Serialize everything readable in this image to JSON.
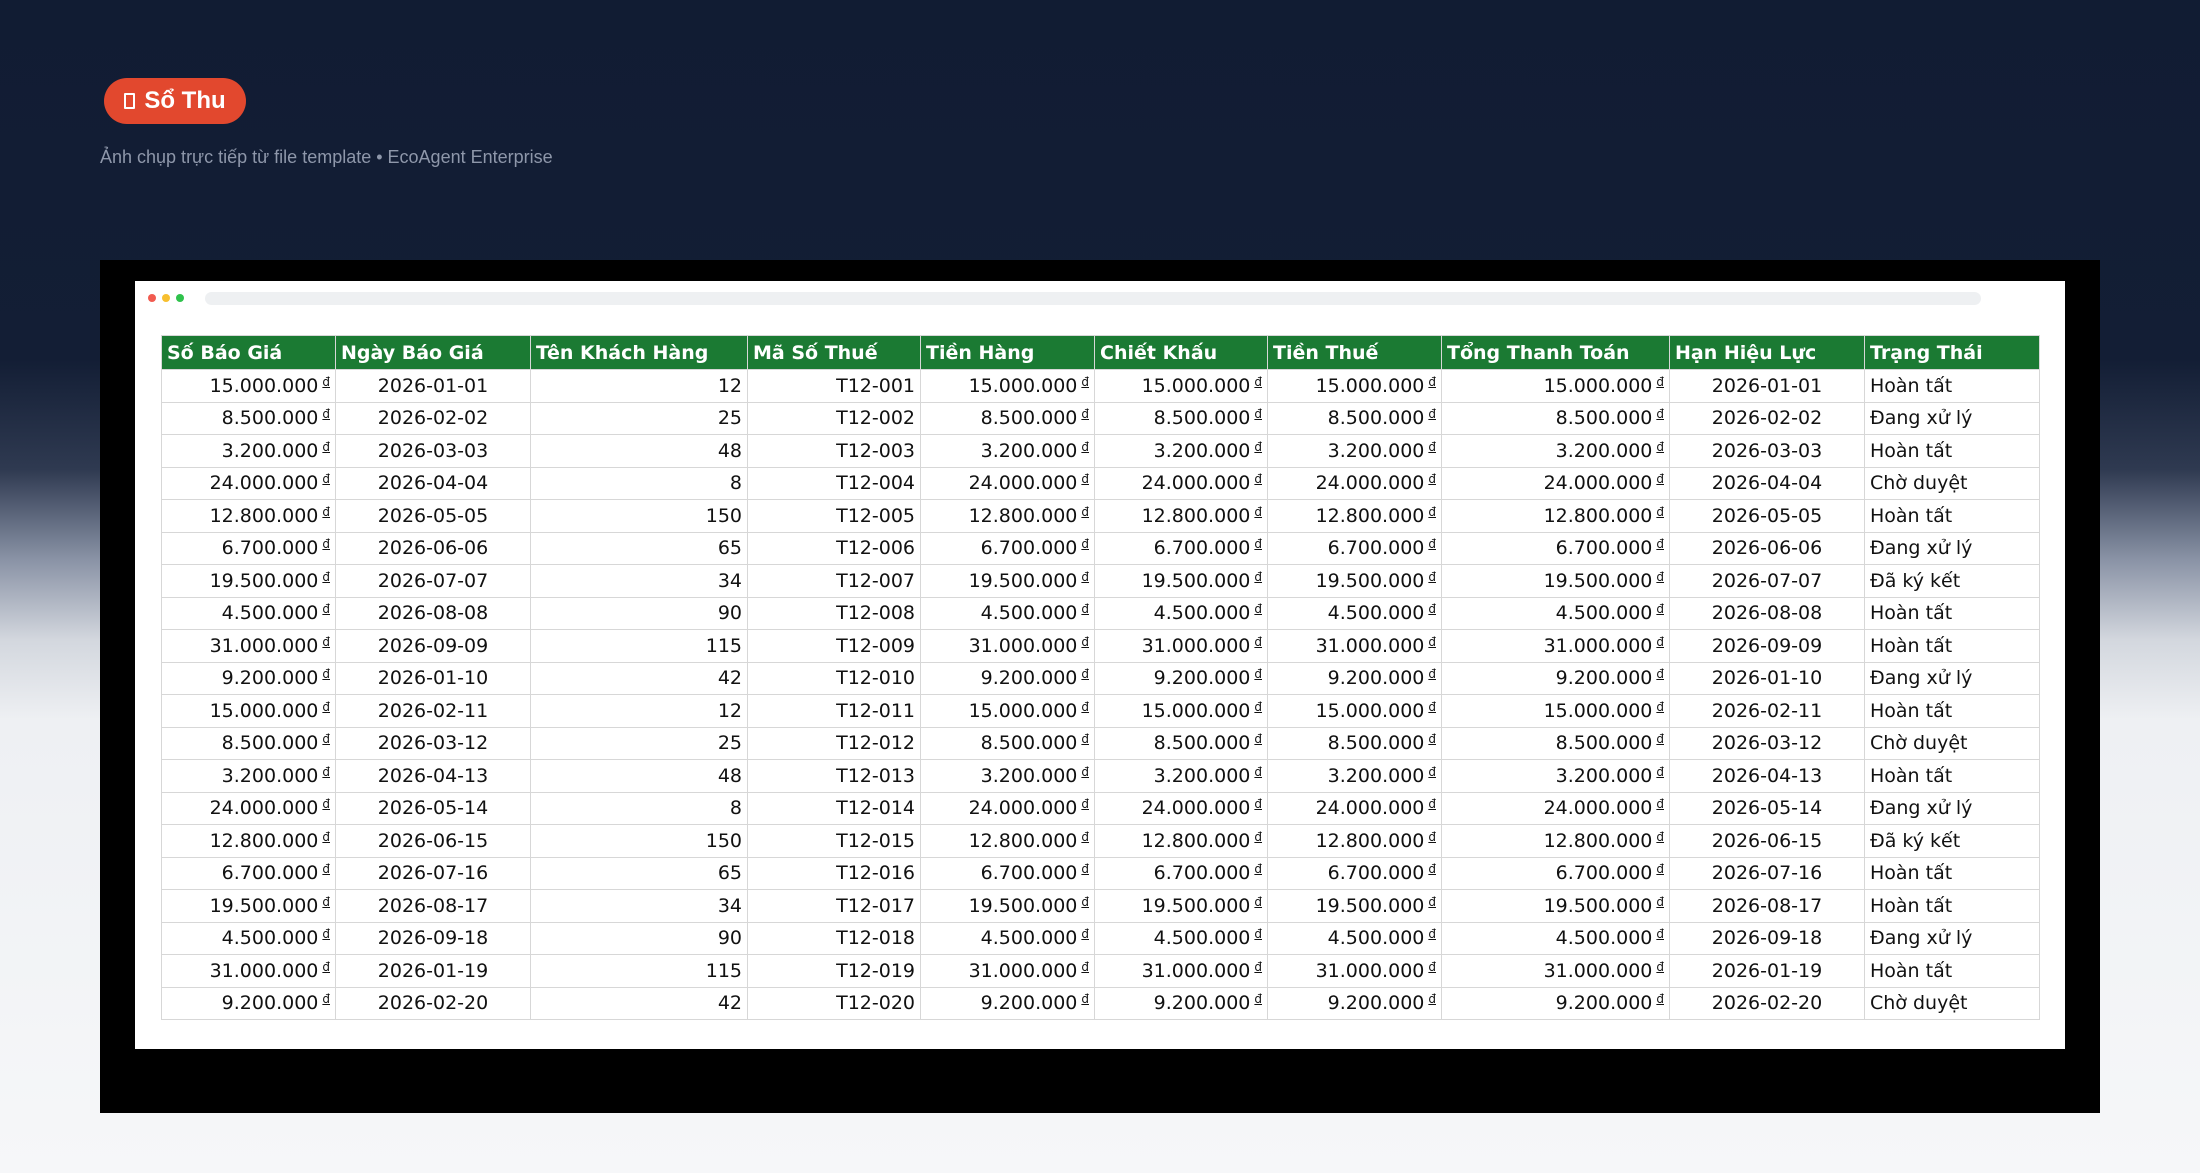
{
  "badge": {
    "label": "Sổ Thu"
  },
  "subtitle": "Ảnh chụp trực tiếp từ file template • EcoAgent Enterprise",
  "sheet": {
    "currency_symbol": "đ",
    "headers": [
      "Số Báo Giá",
      "Ngày Báo Giá",
      "Tên Khách Hàng",
      "Mã Số Thuế",
      "Tiền Hàng",
      "Chiết Khấu",
      "Tiền Thuế",
      "Tổng Thanh Toán",
      "Hạn Hiệu Lực",
      "Trạng Thái"
    ],
    "rows": [
      {
        "amount": "15.000.000",
        "date": "2026-01-01",
        "qty": "12",
        "code": "T12-001",
        "status": "Hoàn tất"
      },
      {
        "amount": "8.500.000",
        "date": "2026-02-02",
        "qty": "25",
        "code": "T12-002",
        "status": "Đang xử lý"
      },
      {
        "amount": "3.200.000",
        "date": "2026-03-03",
        "qty": "48",
        "code": "T12-003",
        "status": "Hoàn tất"
      },
      {
        "amount": "24.000.000",
        "date": "2026-04-04",
        "qty": "8",
        "code": "T12-004",
        "status": "Chờ duyệt"
      },
      {
        "amount": "12.800.000",
        "date": "2026-05-05",
        "qty": "150",
        "code": "T12-005",
        "status": "Hoàn tất"
      },
      {
        "amount": "6.700.000",
        "date": "2026-06-06",
        "qty": "65",
        "code": "T12-006",
        "status": "Đang xử lý"
      },
      {
        "amount": "19.500.000",
        "date": "2026-07-07",
        "qty": "34",
        "code": "T12-007",
        "status": "Đã ký kết"
      },
      {
        "amount": "4.500.000",
        "date": "2026-08-08",
        "qty": "90",
        "code": "T12-008",
        "status": "Hoàn tất"
      },
      {
        "amount": "31.000.000",
        "date": "2026-09-09",
        "qty": "115",
        "code": "T12-009",
        "status": "Hoàn tất"
      },
      {
        "amount": "9.200.000",
        "date": "2026-01-10",
        "qty": "42",
        "code": "T12-010",
        "status": "Đang xử lý"
      },
      {
        "amount": "15.000.000",
        "date": "2026-02-11",
        "qty": "12",
        "code": "T12-011",
        "status": "Hoàn tất"
      },
      {
        "amount": "8.500.000",
        "date": "2026-03-12",
        "qty": "25",
        "code": "T12-012",
        "status": "Chờ duyệt"
      },
      {
        "amount": "3.200.000",
        "date": "2026-04-13",
        "qty": "48",
        "code": "T12-013",
        "status": "Hoàn tất"
      },
      {
        "amount": "24.000.000",
        "date": "2026-05-14",
        "qty": "8",
        "code": "T12-014",
        "status": "Đang xử lý"
      },
      {
        "amount": "12.800.000",
        "date": "2026-06-15",
        "qty": "150",
        "code": "T12-015",
        "status": "Đã ký kết"
      },
      {
        "amount": "6.700.000",
        "date": "2026-07-16",
        "qty": "65",
        "code": "T12-016",
        "status": "Hoàn tất"
      },
      {
        "amount": "19.500.000",
        "date": "2026-08-17",
        "qty": "34",
        "code": "T12-017",
        "status": "Hoàn tất"
      },
      {
        "amount": "4.500.000",
        "date": "2026-09-18",
        "qty": "90",
        "code": "T12-018",
        "status": "Đang xử lý"
      },
      {
        "amount": "31.000.000",
        "date": "2026-01-19",
        "qty": "115",
        "code": "T12-019",
        "status": "Hoàn tất"
      },
      {
        "amount": "9.200.000",
        "date": "2026-02-20",
        "qty": "42",
        "code": "T12-020",
        "status": "Chờ duyệt"
      }
    ]
  }
}
